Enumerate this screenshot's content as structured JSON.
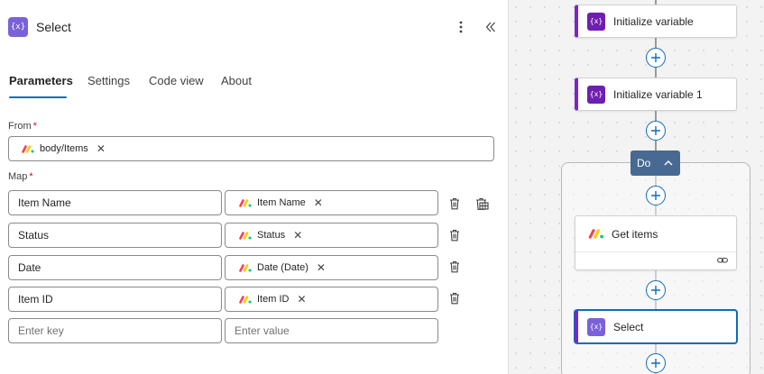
{
  "panel": {
    "icon_glyph": "{x}",
    "title": "Select",
    "more_icon": "more-vertical-icon",
    "collapse_icon": "double-chevron-left-icon"
  },
  "tabs": [
    {
      "label": "Parameters",
      "active": true
    },
    {
      "label": "Settings",
      "active": false
    },
    {
      "label": "Code view",
      "active": false
    },
    {
      "label": "About",
      "active": false
    }
  ],
  "from": {
    "label": "From",
    "required_mark": "*",
    "token": {
      "icon": "monday-logo-icon",
      "text": "body/Items",
      "remove_glyph": "✕"
    }
  },
  "map": {
    "label": "Map",
    "required_mark": "*",
    "rows": [
      {
        "key": "Item Name",
        "value": "Item Name",
        "remove_glyph": "✕"
      },
      {
        "key": "Status",
        "value": "Status",
        "remove_glyph": "✕"
      },
      {
        "key": "Date",
        "value": "Date (Date)",
        "remove_glyph": "✕"
      },
      {
        "key": "Item ID",
        "value": "Item ID",
        "remove_glyph": "✕"
      }
    ],
    "key_placeholder": "Enter key",
    "value_placeholder": "Enter value"
  },
  "canvas": {
    "nodes": {
      "init_var": {
        "label": "Initialize variable",
        "icon_glyph": "{x}"
      },
      "init_var_1": {
        "label": "Initialize variable 1",
        "icon_glyph": "{x}"
      },
      "do_scope": {
        "label": "Do"
      },
      "get_items": {
        "label": "Get items",
        "icon": "monday-logo-icon"
      },
      "select": {
        "label": "Select",
        "icon_glyph": "{x}"
      }
    }
  },
  "colors": {
    "accent": "#0F6CBD",
    "variable_action": "#6E1FB0",
    "select_action": "#7B61D9",
    "scope_header": "#486991",
    "required": "#C50F1F"
  }
}
